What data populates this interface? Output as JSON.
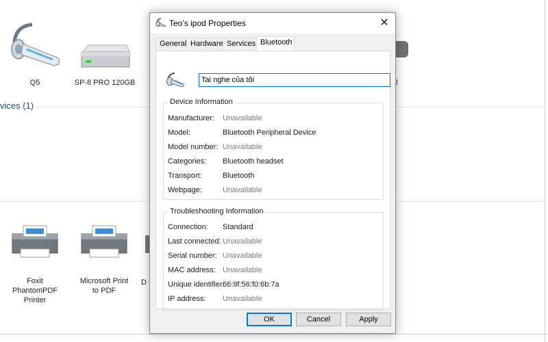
{
  "background": {
    "devices": [
      {
        "label": "Q5"
      },
      {
        "label": "SP-8 PRO 120GB"
      },
      {
        "label": "al"
      }
    ],
    "section_title": "vices (1)",
    "printers": [
      {
        "label": "Foxit PhantomPDF Printer"
      },
      {
        "label": "Microsoft Print to PDF"
      },
      {
        "label": "D"
      }
    ]
  },
  "dialog": {
    "title": "Teo’s ipod Properties",
    "close_symbol": "✕",
    "tabs": [
      "General",
      "Hardware",
      "Services",
      "Bluetooth"
    ],
    "active_tab": "Bluetooth",
    "device_name": "Tai nghe của tôi",
    "device_info": {
      "title": "Device Information",
      "rows": [
        {
          "key": "Manufacturer:",
          "value": "Unavailable"
        },
        {
          "key": "Model:",
          "value": "Bluetooth Peripheral Device"
        },
        {
          "key": "Model number:",
          "value": "Unavailable"
        },
        {
          "key": "Categories:",
          "value": "Bluetooth headset"
        },
        {
          "key": "Transport:",
          "value": "Bluetooth"
        },
        {
          "key": "Webpage:",
          "value": "Unavailable"
        }
      ]
    },
    "troubleshooting": {
      "title": "Troubleshooting Information",
      "rows": [
        {
          "key": "Connection:",
          "value": "Standard"
        },
        {
          "key": "Last connected:",
          "value": "Unavailable"
        },
        {
          "key": "Serial number:",
          "value": "Unavailable"
        },
        {
          "key": "MAC address:",
          "value": "Unavailable"
        },
        {
          "key": "Unique identifier:",
          "value": "66:9f:56:f0:6b:7a"
        },
        {
          "key": "IP address:",
          "value": "Unavailable"
        }
      ]
    },
    "buttons": {
      "ok": "OK",
      "cancel": "Cancel",
      "apply": "Apply"
    }
  },
  "colors": {
    "accent": "#0078d7",
    "unavailable_text": "#7a7a7a",
    "section_title": "#1b4c8a"
  },
  "icons": [
    "headset-icon",
    "drive-icon",
    "printer-icon",
    "close-icon"
  ]
}
